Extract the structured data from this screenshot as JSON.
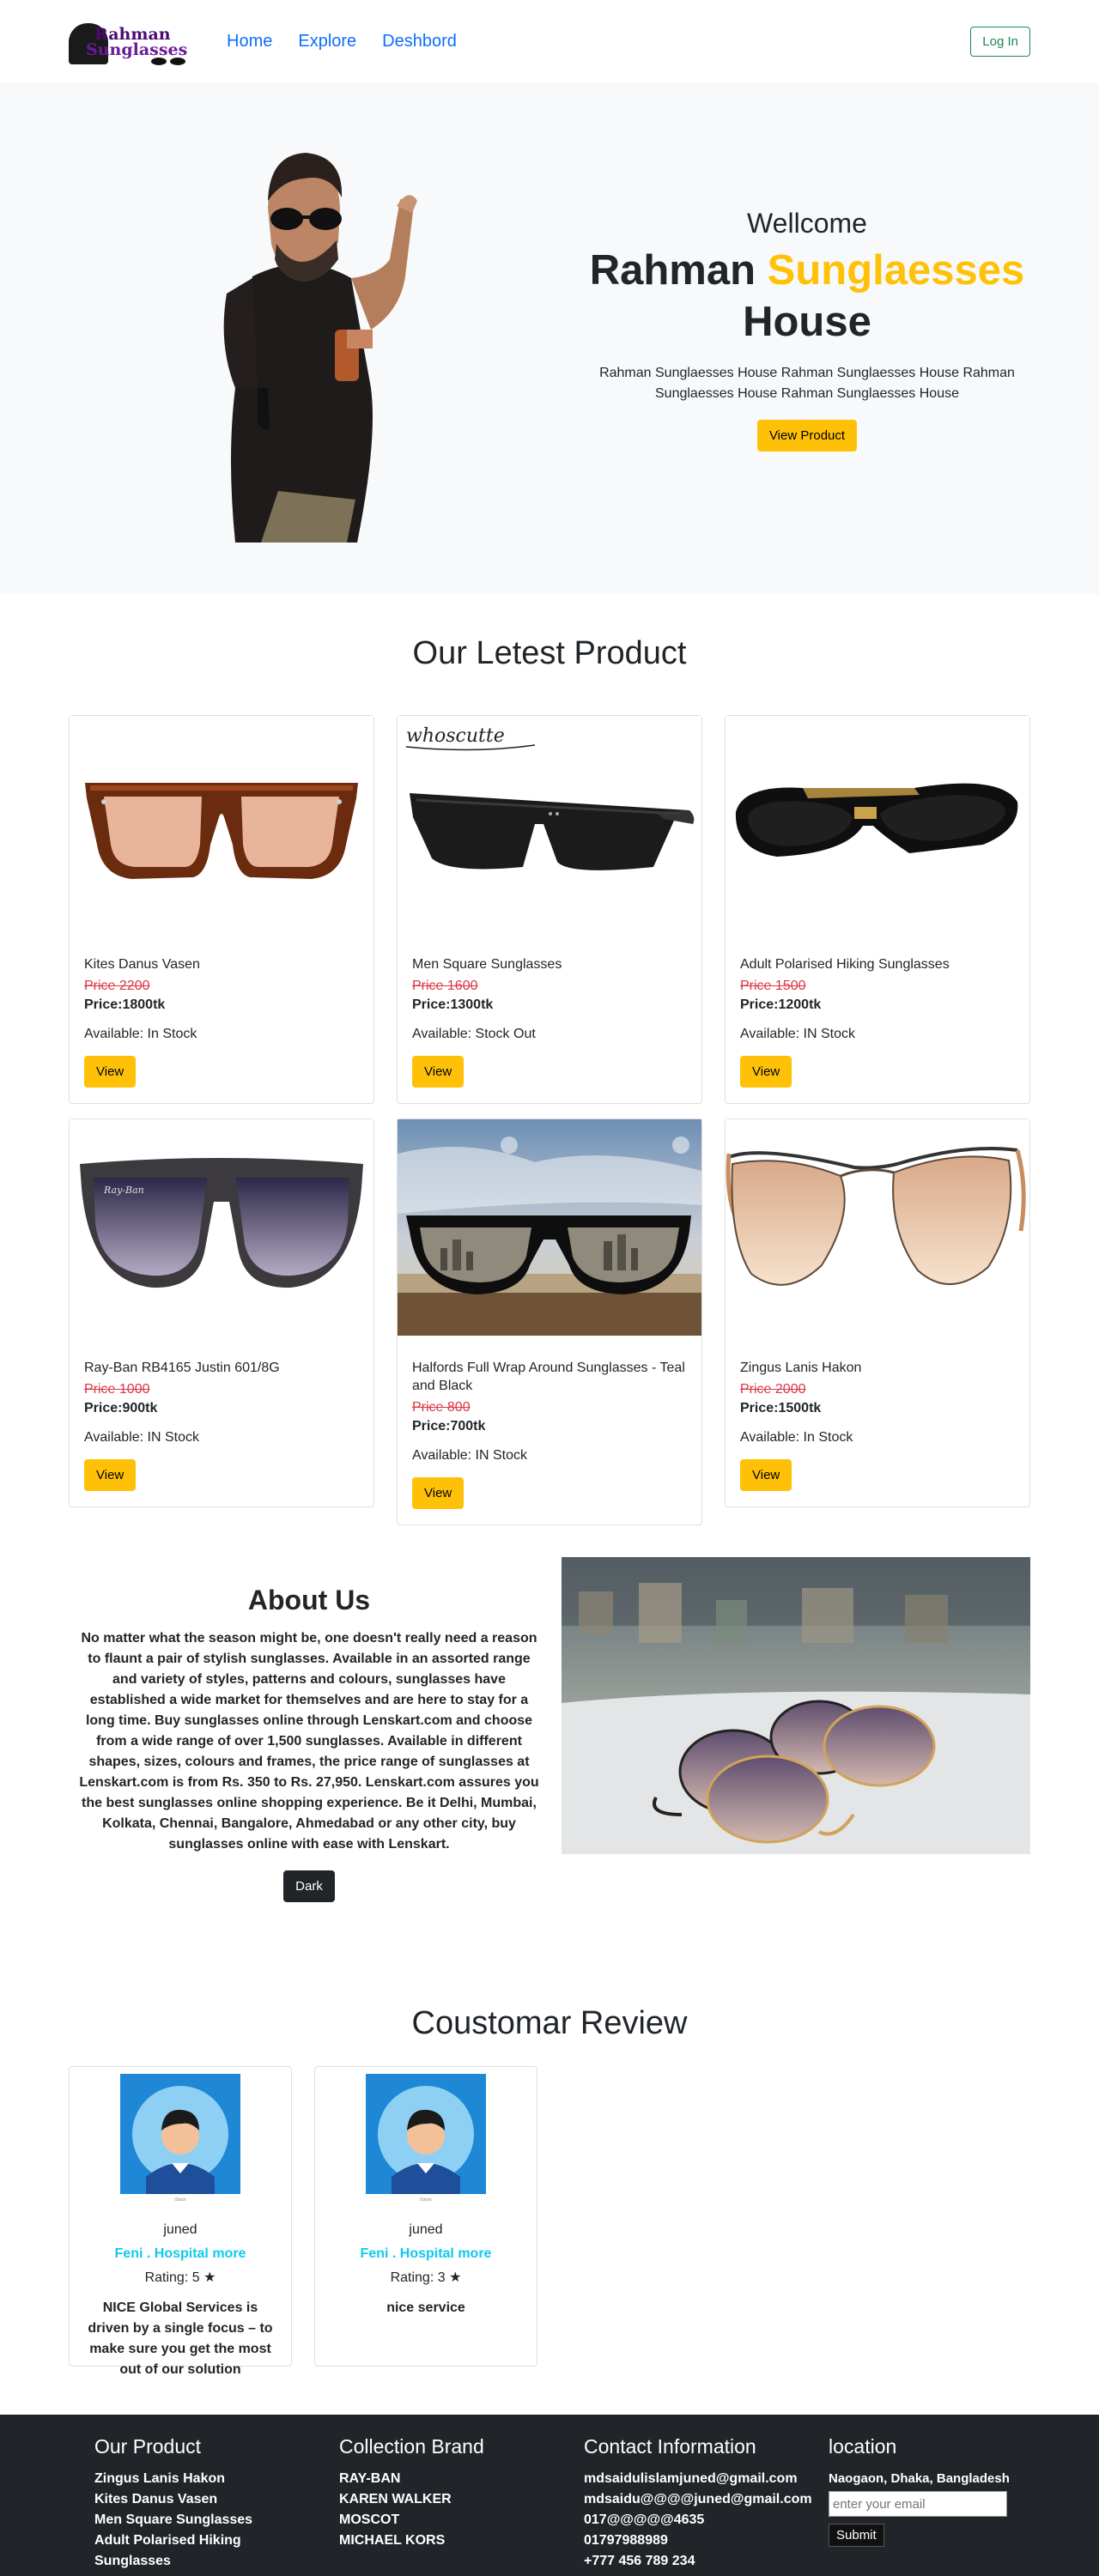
{
  "nav": {
    "logo_line1": "Rahman",
    "logo_line2": "Sunglasses",
    "links": [
      "Home",
      "Explore",
      "Deshbord"
    ],
    "login": "Log In"
  },
  "hero": {
    "welcome": "Wellcome",
    "title_part1": "Rahman",
    "title_highlight": "Sunglaesses",
    "title_part2": "House",
    "description": "Rahman Sunglaesses House Rahman Sunglaesses House Rahman Sunglaesses House Rahman Sunglaesses House",
    "button": "View Product"
  },
  "products": {
    "title": "Our Letest Product",
    "items": [
      {
        "name": "Kites Danus Vasen",
        "old_price": "Price 2200",
        "price": "Price:1800tk",
        "available": "Available: In Stock",
        "button": "View"
      },
      {
        "name": "Men Square Sunglasses",
        "old_price": "Price 1600",
        "price": "Price:1300tk",
        "available": "Available: Stock Out",
        "button": "View",
        "watermark": "whoscutte"
      },
      {
        "name": "Adult Polarised Hiking Sunglasses",
        "old_price": "Price 1500",
        "price": "Price:1200tk",
        "available": "Available: IN Stock",
        "button": "View"
      },
      {
        "name": "Ray-Ban RB4165 Justin 601/8G",
        "old_price": "Price 1000",
        "price": "Price:900tk",
        "available": "Available: IN Stock",
        "button": "View"
      },
      {
        "name": "Halfords Full Wrap Around Sunglasses - Teal and Black",
        "old_price": "Price 800",
        "price": "Price:700tk",
        "available": "Available: IN Stock",
        "button": "View"
      },
      {
        "name": "Zingus Lanis Hakon",
        "old_price": "Price 2000",
        "price": "Price:1500tk",
        "available": "Available: In Stock",
        "button": "View"
      }
    ]
  },
  "about": {
    "title": "About Us",
    "text": "No matter what the season might be, one doesn't really need a reason to flaunt a pair of stylish sunglasses. Available in an assorted range and variety of styles, patterns and colours, sunglasses have established a wide market for themselves and are here to stay for a long time. Buy sunglasses online through Lenskart.com and choose from a wide range of over 1,500 sunglasses. Available in different shapes, sizes, colours and frames, the price range of sunglasses at Lenskart.com is from Rs. 350 to Rs. 27,950. Lenskart.com assures you the best sunglasses online shopping experience. Be it Delhi, Mumbai, Kolkata, Chennai, Bangalore, Ahmedabad or any other city, buy sunglasses online with ease with Lenskart.",
    "button": "Dark"
  },
  "reviews": {
    "title": "Coustomar Review",
    "items": [
      {
        "name": "juned",
        "location": "Feni . Hospital more",
        "rating_label": "Rating: 5",
        "rating": 5,
        "text": "NICE Global Services is driven by a single focus – to make sure you get the most out of our solution"
      },
      {
        "name": "juned",
        "location": "Feni . Hospital more",
        "rating_label": "Rating: 3",
        "rating": 3,
        "text": "nice service"
      }
    ]
  },
  "footer": {
    "product": {
      "title": "Our Product",
      "items": [
        "Zingus Lanis Hakon",
        "Kites Danus Vasen",
        "Men Square Sunglasses",
        "Adult Polarised Hiking Sunglasses"
      ]
    },
    "brands": {
      "title": "Collection Brand",
      "items": [
        "RAY-BAN",
        "KAREN WALKER",
        "MOSCOT",
        "MICHAEL KORS"
      ]
    },
    "contact": {
      "title": "Contact Information",
      "items": [
        "mdsaidulislamjuned@gmail.com",
        "mdsaidu@@@@juned@gmail.com",
        "017@@@@@4635",
        "01797988989",
        "+777 456 789 234"
      ]
    },
    "location": {
      "title": "location",
      "address": "Naogaon, Dhaka, Bangladesh",
      "email_placeholder": "enter your email",
      "submit": "Submit"
    }
  },
  "colors": {
    "accent": "#ffc107",
    "link": "#0d6efd",
    "strike": "#dc3545",
    "info": "#0dcaf0",
    "dark": "#212529"
  }
}
